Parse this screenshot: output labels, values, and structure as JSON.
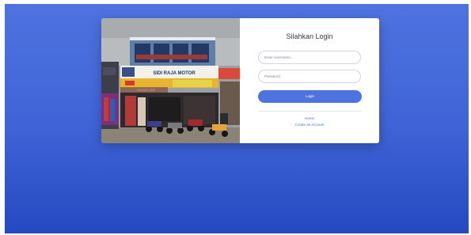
{
  "login": {
    "title": "Silahkan Login",
    "username_placeholder": "Enter Username...",
    "password_placeholder": "Password",
    "login_button": "Login",
    "home_link": "Home",
    "register_link": "Create an Account"
  },
  "photo": {
    "sign_main": "SIDI RAJA MOTOR",
    "sign_left": "SIGNATURE"
  },
  "colors": {
    "background_top": "#4e73df",
    "background_bottom": "#2448c0",
    "accent": "#4e73df"
  }
}
